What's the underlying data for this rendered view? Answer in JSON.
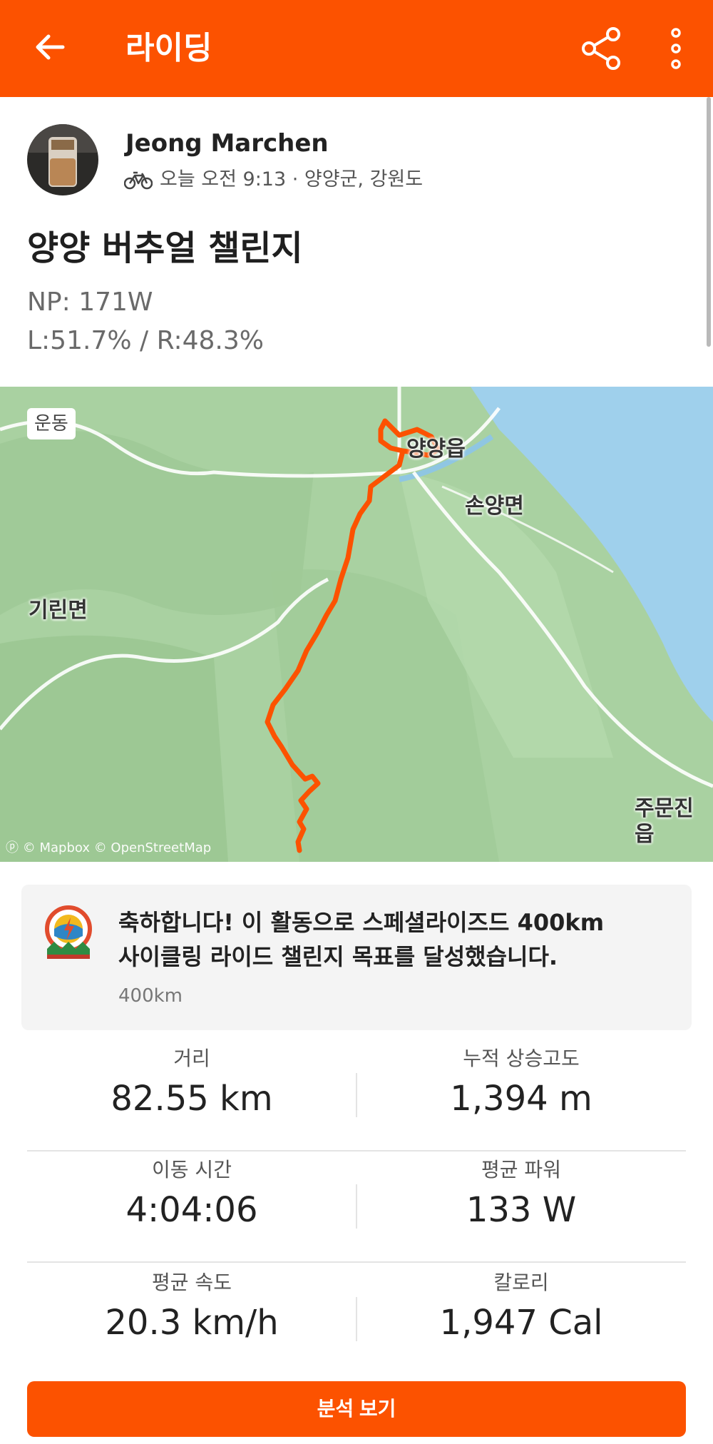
{
  "header": {
    "title": "라이딩",
    "back_icon": "arrow-left-icon",
    "share_icon": "share-icon",
    "more_icon": "more-vertical-icon",
    "color": "#fc5200"
  },
  "athlete": {
    "name": "Jeong Marchen",
    "activity_icon": "bicycle-icon",
    "meta": "오늘 오전 9:13 · 양양군, 강원도"
  },
  "activity": {
    "title": "양양 버추얼 챌린지",
    "description": [
      "NP: 171W",
      "L:51.7% / R:48.3%"
    ]
  },
  "map": {
    "badge": "운동",
    "places": [
      "양양읍",
      "손양면",
      "기린면",
      "주문진읍"
    ],
    "attribution": "© Mapbox © OpenStreetMap",
    "route_color": "#fc5200",
    "sea_color": "#9fd0ec"
  },
  "achievement": {
    "icon": "challenge-badge-icon",
    "line1": "축하합니다! 이 활동으로 스페셜라이즈드 400km",
    "line2": "사이클링 라이드 챌린지 목표를 달성했습니다.",
    "goal": "400km"
  },
  "stats": [
    {
      "label": "거리",
      "value": "82.55 km"
    },
    {
      "label": "누적 상승고도",
      "value": "1,394 m"
    },
    {
      "label": "이동 시간",
      "value": "4:04:06"
    },
    {
      "label": "평균 파워",
      "value": "133 W"
    },
    {
      "label": "평균 속도",
      "value": "20.3 km/h"
    },
    {
      "label": "칼로리",
      "value": "1,947 Cal"
    }
  ],
  "actions": {
    "analyze_label": "분석 보기"
  }
}
